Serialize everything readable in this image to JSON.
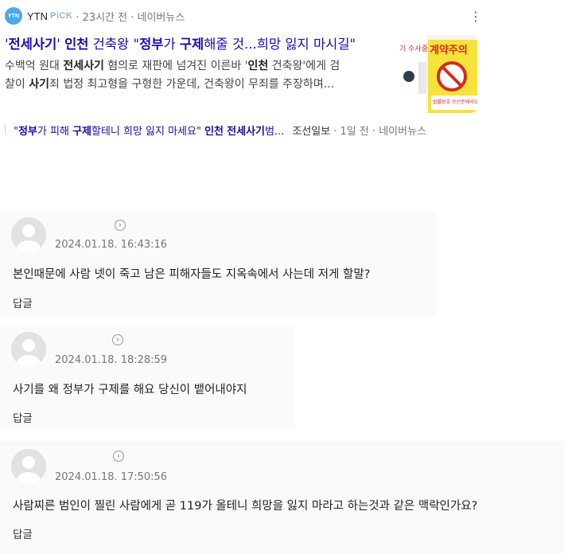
{
  "news": {
    "source": {
      "logo_text": "YTN",
      "name": "YTN",
      "pick": "PiCK",
      "meta": "· 23시간 전 · 네이버뉴스"
    },
    "more_icon": "⋮",
    "headline": {
      "p1": "'",
      "k1": "전세사기",
      "p2": "' ",
      "k2": "인천",
      "p3": " 건축왕 \"",
      "k3": "정부",
      "p4": "가 ",
      "k4": "구제",
      "p5": "해줄 것...희망 잃지 마시길\""
    },
    "summary": {
      "p1": "수백억 원대 ",
      "k1": "전세사기",
      "p2": " 혐의로 재판에 넘겨진 이른바 '",
      "k2": "인천",
      "p3": " 건축왕'에게 검",
      "p4": "찰이 ",
      "k3": "사기",
      "p5": "죄 법정 최고형을 구형한 가운데, 건축왕이 무죄를 주장하며..."
    },
    "thumbnail": {
      "sign_top": "계약주의",
      "side_text": "기 수사중",
      "small_text": "법률보호 오신분께서도"
    },
    "related": {
      "p1": "\"",
      "k1": "정부",
      "p2": "가 피해 ",
      "k2": "구제",
      "p3": "할테니 희망 잃지 마세요\" ",
      "k3": "인천",
      "p4": " ",
      "k4": "전세사기",
      "p5": "범...",
      "source": "조선일보",
      "meta": "· 1일 전 · 네이버뉴스"
    }
  },
  "comments": [
    {
      "date": "2024.01.18. 16:43:16",
      "text": "본인때문에 사람 넷이 죽고 남은 피해자들도 지옥속에서 사는데 저게 할말?",
      "reply": "답글",
      "chev": "›"
    },
    {
      "date": "2024.01.18. 18:28:59",
      "text": "사기를 왜 정부가 구제를 해요 당신이 뱉어내야지",
      "reply": "답글",
      "chev": "›"
    },
    {
      "date": "2024.01.18. 17:50:56",
      "text": "사람찌른 범인이 찔린 사람에게 곧 119가 올테니 희망을 잃지 마라고 하는것과 같은 맥락인가요?",
      "reply": "답글",
      "chev": "›"
    }
  ]
}
